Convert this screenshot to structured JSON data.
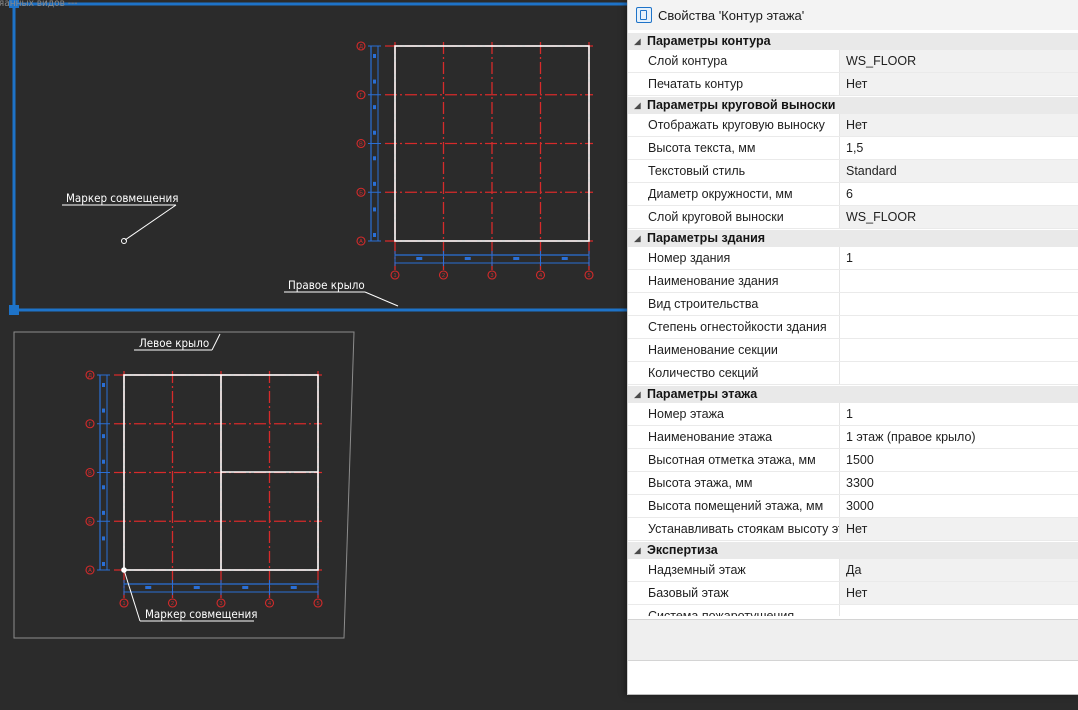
{
  "cad": {
    "top_fragment": "зяанных видов ---",
    "marker_label_1": "Маркер совмещения",
    "marker_label_2": "Маркер совмещения",
    "right_wing_label": "Правое крыло",
    "left_wing_label": "Левое крыло",
    "right_axis_top": [
      "1",
      "2",
      "3",
      "4",
      "5"
    ],
    "right_axis_side": [
      "А",
      "Б",
      "В",
      "Г",
      "Д"
    ],
    "left_axis_bottom": [
      "1",
      "2",
      "3",
      "4",
      "5"
    ],
    "left_axis_side": [
      "А",
      "Б",
      "В",
      "Г",
      "Д"
    ]
  },
  "panel": {
    "title": "Свойства 'Контур этажа'",
    "categories": [
      {
        "name": "Параметры контура",
        "rows": [
          {
            "key": "Слой контура",
            "value": "WS_FLOOR",
            "shaded": true
          },
          {
            "key": "Печатать контур",
            "value": "Нет",
            "shaded": true
          }
        ]
      },
      {
        "name": "Параметры круговой выноски",
        "rows": [
          {
            "key": "Отображать круговую выноску",
            "value": "Нет",
            "shaded": true
          },
          {
            "key": "Высота текста, мм",
            "value": "1,5",
            "shaded": false
          },
          {
            "key": "Текстовый стиль",
            "value": "Standard",
            "shaded": true
          },
          {
            "key": "Диаметр окружности, мм",
            "value": "6",
            "shaded": false
          },
          {
            "key": "Слой круговой выноски",
            "value": "WS_FLOOR",
            "shaded": true
          }
        ]
      },
      {
        "name": "Параметры здания",
        "rows": [
          {
            "key": "Номер здания",
            "value": "1",
            "shaded": false
          },
          {
            "key": "Наименование здания",
            "value": "",
            "shaded": false
          },
          {
            "key": "Вид строительства",
            "value": "",
            "shaded": false
          },
          {
            "key": "Степень огнестойкости здания",
            "value": "",
            "shaded": false
          },
          {
            "key": "Наименование секции",
            "value": "",
            "shaded": false
          },
          {
            "key": "Количество секций",
            "value": "",
            "shaded": false
          }
        ]
      },
      {
        "name": "Параметры этажа",
        "rows": [
          {
            "key": "Номер этажа",
            "value": "1",
            "shaded": false
          },
          {
            "key": "Наименование этажа",
            "value": "1 этаж (правое крыло)",
            "shaded": false
          },
          {
            "key": "Высотная отметка этажа, мм",
            "value": "1500",
            "shaded": false
          },
          {
            "key": "Высота этажа, мм",
            "value": "3300",
            "shaded": false
          },
          {
            "key": "Высота помещений этажа, мм",
            "value": "3000",
            "shaded": false
          },
          {
            "key": "Устанавливать стоякам высоту этаж...",
            "value": "Нет",
            "shaded": true
          }
        ]
      },
      {
        "name": "Экспертиза",
        "rows": [
          {
            "key": "Надземный этаж",
            "value": "Да",
            "shaded": true
          },
          {
            "key": "Базовый этаж",
            "value": "Нет",
            "shaded": true
          },
          {
            "key": "Система пожаротушения",
            "value": "",
            "shaded": false
          }
        ]
      }
    ]
  },
  "colors": {
    "canvas": "#2b2b2b",
    "frame_blue": "#1e73c8",
    "axis_red": "#d62b2b",
    "dim_blue": "#2a6fd6"
  }
}
